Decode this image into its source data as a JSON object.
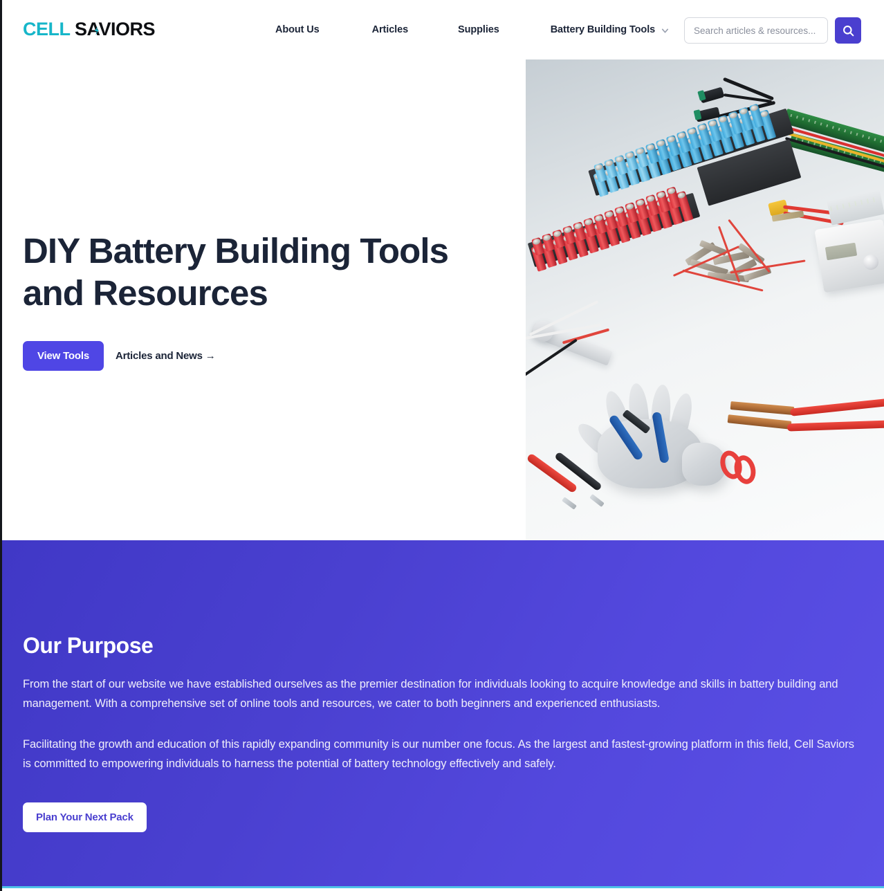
{
  "brand": {
    "name_part1": "CELL",
    "name_part2": "SAVIORS",
    "color_part1": "#17b6c9",
    "color_part2": "#0d0f12"
  },
  "header": {
    "nav": [
      {
        "label": "About Us",
        "has_dropdown": false
      },
      {
        "label": "Articles",
        "has_dropdown": false
      },
      {
        "label": "Supplies",
        "has_dropdown": false
      },
      {
        "label": "Battery Building Tools",
        "has_dropdown": true,
        "icon": "chevron-down-icon"
      }
    ],
    "search": {
      "placeholder": "Search articles & resources...",
      "value": "",
      "button_icon": "search-icon",
      "button_color": "#4a3fcf"
    }
  },
  "hero": {
    "title": "DIY Battery Building Tools and Resources",
    "primary_button": "View Tools",
    "secondary_link": "Articles and News →",
    "image_alt": "Lithium 18650 cells in blue and red arranged in holders with BMS boards, nickel strips, spot welder probes, wire cutters, safety glove and multimeter leads"
  },
  "purpose": {
    "heading": "Our Purpose",
    "paragraph_1": "From the start of our website we have established ourselves as the premier destination for individuals looking to acquire knowledge and skills in battery building and management. With a comprehensive set of online tools and resources, we cater to both beginners and experienced enthusiasts.",
    "paragraph_2": "Facilitating the growth and education of this rapidly expanding community is our number one focus. As the largest and fastest-growing platform in this field, Cell Saviors is committed to empowering individuals to harness the potential of battery technology effectively and safely.",
    "button": "Plan Your Next Pack",
    "bg_color": "#4f46e5",
    "button_text_color": "#4a3fcf"
  },
  "accent": {
    "purple": "#4f46e5",
    "teal": "#17b6c9",
    "bottom_strip": "#4fc3e8"
  }
}
